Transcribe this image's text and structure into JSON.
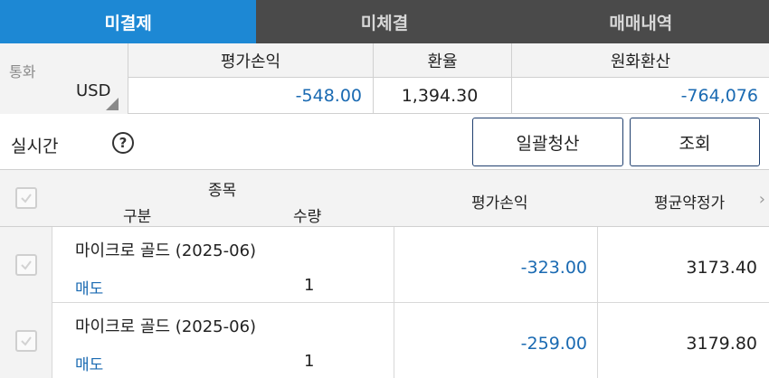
{
  "tabs": [
    {
      "label": "미결제",
      "active": true
    },
    {
      "label": "미체결",
      "active": false
    },
    {
      "label": "매매내역",
      "active": false
    }
  ],
  "summary": {
    "currency_label": "통화",
    "currency_value": "USD",
    "headers": [
      "평가손익",
      "환율",
      "원화환산"
    ],
    "values": [
      "-548.00",
      "1,394.30",
      "-764,076"
    ]
  },
  "realtime": {
    "label": "실시간",
    "help_icon": "?",
    "buttons": [
      "일괄청산",
      "조회"
    ]
  },
  "table": {
    "headers": {
      "item": "종목",
      "side": "구분",
      "qty": "수량",
      "pl": "평가손익",
      "avg": "평균약정가"
    },
    "scroll_icon": "›",
    "rows": [
      {
        "name": "마이크로 골드 (2025-06)",
        "side": "매도",
        "qty": "1",
        "pl": "-323.00",
        "avg": "3173.40"
      },
      {
        "name": "마이크로 골드 (2025-06)",
        "side": "매도",
        "qty": "1",
        "pl": "-259.00",
        "avg": "3179.80"
      }
    ]
  },
  "colors": {
    "active_tab": "#1d88d4",
    "tab_bar": "#4a4a4a",
    "negative_value": "#1a6ab2",
    "button_border": "#1f3f6e"
  }
}
